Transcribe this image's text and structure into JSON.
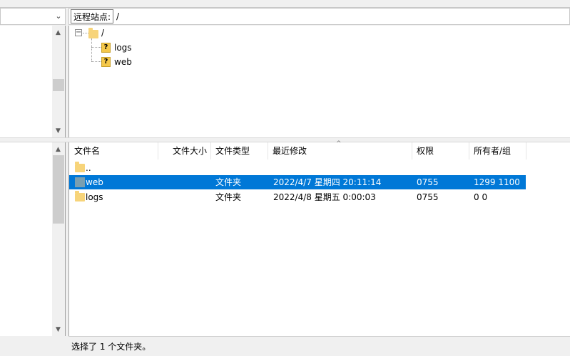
{
  "remote": {
    "site_label": "远程站点:",
    "path": "/",
    "tree": [
      {
        "name": "/",
        "icon": "folder-icon"
      },
      {
        "name": "logs",
        "icon": "unknown-folder-icon"
      },
      {
        "name": "web",
        "icon": "unknown-folder-icon"
      }
    ],
    "columns": [
      "文件名",
      "文件大小",
      "文件类型",
      "最近修改",
      "权限",
      "所有者/组"
    ],
    "rows": [
      {
        "name": "..",
        "size": "",
        "type": "",
        "modified": "",
        "perm": "",
        "owner": "",
        "selected": false
      },
      {
        "name": "web",
        "size": "",
        "type": "文件夹",
        "modified": "2022/4/7 星期四 20:11:14",
        "perm": "0755",
        "owner": "1299 1100",
        "selected": true
      },
      {
        "name": "logs",
        "size": "",
        "type": "文件夹",
        "modified": "2022/4/8 星期五 0:00:03",
        "perm": "0755",
        "owner": "0 0",
        "selected": false
      }
    ],
    "status": "选择了 1 个文件夹。"
  },
  "colors": {
    "selection": "#0078d7",
    "folder": "#f7d47a"
  }
}
